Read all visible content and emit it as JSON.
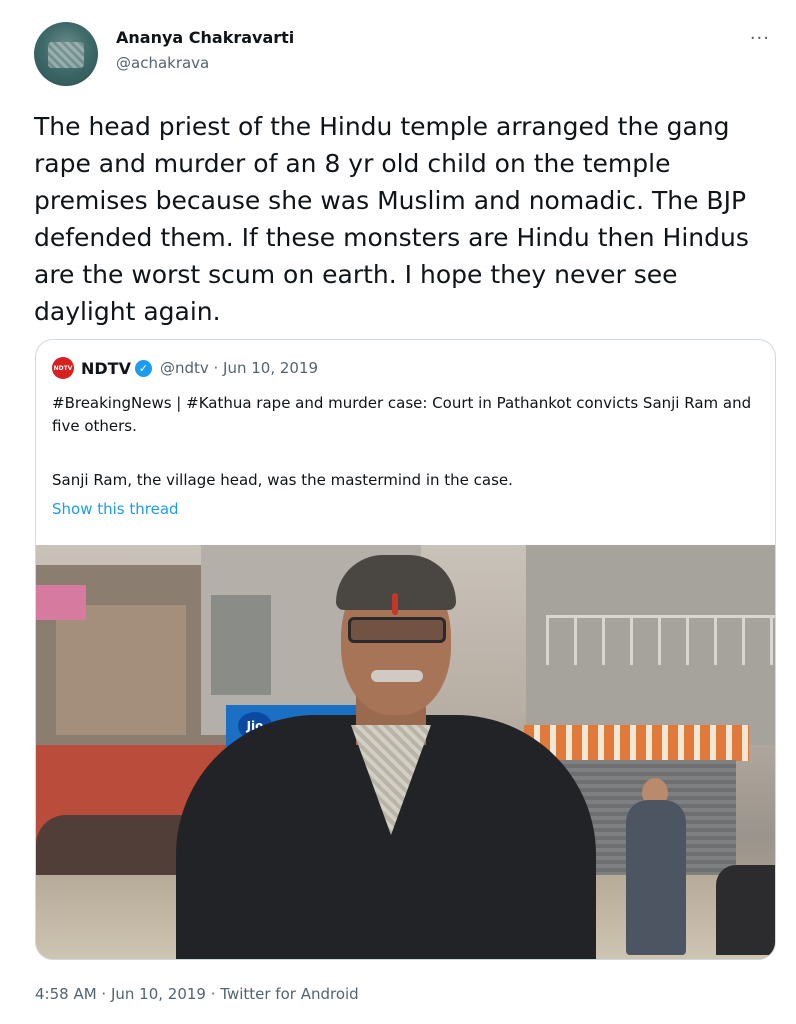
{
  "author": {
    "name": "Ananya Chakravarti",
    "handle": "@achakrava",
    "more_icon": "more-icon"
  },
  "tweet": {
    "text": "The head priest of the Hindu temple arranged the gang rape and murder of an 8 yr old child on the temple premises because she was Muslim and nomadic. The BJP defended them. If these monsters are Hindu then Hindus are the worst scum on earth. I hope they never see daylight again."
  },
  "quoted_tweet": {
    "logo_text": "NDTV",
    "name": "NDTV",
    "verified_icon": "verified-badge-icon",
    "handle_date": "@ndtv · Jun 10, 2019",
    "text_line1": "#BreakingNews | #Kathua rape and murder case: Court in Pathankot convicts Sanji Ram and five others.",
    "text_line2": "Sanji Ram, the village head, was the mastermind in the case.",
    "show_thread": "Show this thread",
    "photo": {
      "jio_sign": "Jio"
    }
  },
  "meta": {
    "timestamp": "4:58 AM · Jun 10, 2019 · Twitter for Android"
  },
  "colors": {
    "link": "#1d9bf0",
    "secondary_text": "#536471",
    "ndtv_red": "#d7201f"
  }
}
